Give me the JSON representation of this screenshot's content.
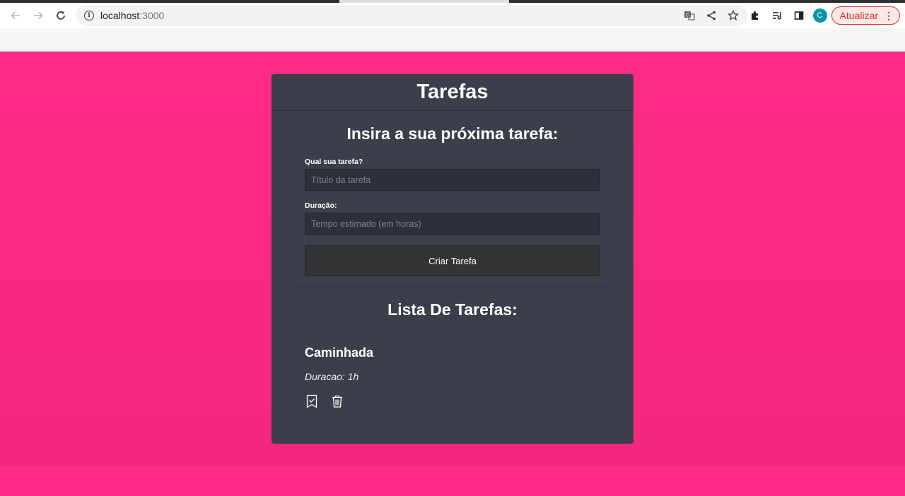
{
  "browser": {
    "url_host": "localhost",
    "url_port": ":3000",
    "avatar_initial": "C",
    "update_label": "Atualizar"
  },
  "app": {
    "title": "Tarefas",
    "form": {
      "heading": "Insira a sua próxima tarefa:",
      "task_label": "Qual sua tarefa?",
      "task_placeholder": "Título da tarefa",
      "task_value": "",
      "duration_label": "Duração:",
      "duration_placeholder": "Tempo estimado (em horas)",
      "duration_value": "",
      "submit_label": "Criar Tarefa"
    },
    "list": {
      "heading": "Lista De Tarefas:",
      "tasks": [
        {
          "title": "Caminhada",
          "duration": "Duracao: 1h"
        }
      ]
    }
  },
  "icons": {
    "back": "arrow-left-icon",
    "forward": "arrow-right-icon",
    "reload": "reload-icon",
    "site_info": "info-icon",
    "translate": "translate-icon",
    "share": "share-icon",
    "bookmark": "star-icon",
    "extensions": "puzzle-icon",
    "reading_list": "reading-list-icon",
    "side_panel": "side-panel-icon",
    "complete_task": "bookmark-check-icon",
    "delete_task": "trash-icon"
  },
  "colors": {
    "page_background": "#ff2b86",
    "card_background": "#3a3f4b",
    "input_background": "#2d3038",
    "button_background": "#333435",
    "update_accent": "#d93025"
  }
}
